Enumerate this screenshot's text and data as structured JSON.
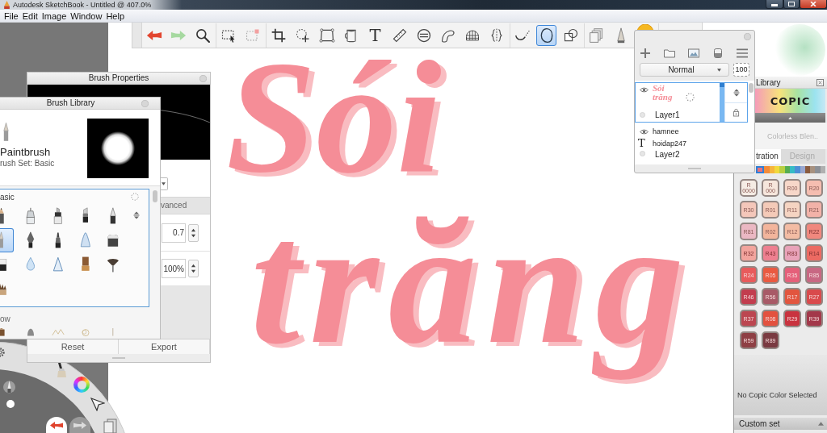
{
  "window": {
    "title": "Autodesk SketchBook - Untitled @ 407.0%"
  },
  "menu": [
    "File",
    "Edit",
    "Image",
    "Window",
    "Help"
  ],
  "toolbar": {
    "groups": [
      [
        {
          "kind": "undo",
          "selected": false
        },
        {
          "kind": "redo",
          "selected": false
        },
        {
          "kind": "zoom",
          "selected": false
        }
      ],
      [
        {
          "kind": "select",
          "selected": false
        },
        {
          "kind": "selectmove",
          "selected": false
        }
      ],
      [
        {
          "kind": "crop",
          "selected": false
        },
        {
          "kind": "transform",
          "selected": false
        },
        {
          "kind": "distort",
          "selected": false
        },
        {
          "kind": "fill",
          "selected": false
        },
        {
          "kind": "text",
          "glyph": "T",
          "selected": false
        },
        {
          "kind": "ruler",
          "selected": false
        },
        {
          "kind": "ellipse",
          "selected": false
        },
        {
          "kind": "curve",
          "selected": false
        },
        {
          "kind": "perspective",
          "selected": false
        },
        {
          "kind": "symmetry",
          "selected": false
        }
      ],
      [
        {
          "kind": "stroke",
          "selected": false
        },
        {
          "kind": "predictive",
          "selected": true
        },
        {
          "kind": "shapes",
          "selected": false
        }
      ],
      [
        {
          "kind": "copy",
          "selected": false
        },
        {
          "kind": "brush",
          "selected": false
        },
        {
          "kind": "color",
          "selected": false
        }
      ]
    ]
  },
  "canvas": {
    "lettering": [
      "Sói",
      "trăng"
    ]
  },
  "brush_properties": {
    "title": "Brush Properties",
    "tab": {
      "label": "vanced",
      "selected": false
    },
    "fields": [
      {
        "value": "0.7"
      },
      {
        "value": "100%"
      }
    ],
    "buttons": [
      "Reset",
      "Export"
    ]
  },
  "brush_library": {
    "title": "Brush Library",
    "brush_name": "Paintbrush",
    "brush_set": "rush Set: Basic",
    "sections": [
      {
        "label": "asic",
        "selected": true,
        "brushes": [
          {
            "kind": "pencil",
            "selected": false
          },
          {
            "kind": "techpen",
            "selected": false
          },
          {
            "kind": "marker",
            "selected": false
          },
          {
            "kind": "chisel",
            "selected": false
          },
          {
            "kind": "ballpoint",
            "selected": false
          },
          {
            "kind": "paintbrush",
            "selected": true
          },
          {
            "kind": "nib",
            "selected": false
          },
          {
            "kind": "felt",
            "selected": false
          },
          {
            "kind": "airbrush",
            "selected": false
          },
          {
            "kind": "eraser",
            "selected": false
          },
          {
            "kind": "block",
            "selected": false
          },
          {
            "kind": "drop",
            "selected": false
          },
          {
            "kind": "cone",
            "selected": false
          },
          {
            "kind": "stamp",
            "selected": false
          },
          {
            "kind": "fan",
            "selected": false
          },
          {
            "kind": "bristle",
            "selected": false
          }
        ]
      },
      {
        "label": "ow",
        "selected": false,
        "brushes": [
          {
            "kind": "dab",
            "selected": false
          },
          {
            "kind": "blob",
            "selected": false
          },
          {
            "kind": "sketch",
            "selected": false
          },
          {
            "kind": "loop",
            "selected": false
          },
          {
            "kind": "hair",
            "selected": false
          }
        ]
      }
    ]
  },
  "layers": {
    "blend_mode": "Normal",
    "opacity": "100",
    "items": [
      {
        "name": "Layer1",
        "kind": "paint",
        "visible": true,
        "selected": true,
        "thumbnail": [
          "Sói",
          "trăng"
        ]
      },
      {
        "name": "Layer2",
        "kind": "text",
        "glyph": "T",
        "visible": true,
        "selected": false,
        "thumbnail": [
          "hamnee",
          "hoidap247"
        ]
      }
    ]
  },
  "copic_library": {
    "title": "Library",
    "logo": "COPIC",
    "blender": "Colorless Blen..",
    "tabs": [
      {
        "label": "tration",
        "selected": true
      },
      {
        "label": "Design",
        "selected": false
      }
    ],
    "families": [
      {
        "color": "#e8727c",
        "selected": true
      },
      {
        "color": "#f28b3b",
        "selected": false
      },
      {
        "color": "#f6b53c",
        "selected": false
      },
      {
        "color": "#f1d93c",
        "selected": false
      },
      {
        "color": "#b8cf41",
        "selected": false
      },
      {
        "color": "#55ad52",
        "selected": false
      },
      {
        "color": "#36bcc4",
        "selected": false
      },
      {
        "color": "#4c8fd6",
        "selected": false
      },
      {
        "color": "#98a6cf",
        "selected": false
      },
      {
        "color": "#8a5b3e",
        "selected": false
      },
      {
        "color": "#a7917f",
        "selected": false
      },
      {
        "color": "#8c9096",
        "selected": false
      },
      {
        "color": "#b0b0b0",
        "selected": false
      }
    ],
    "swatches": [
      {
        "label": "R\n0000",
        "color": "#f5ece4"
      },
      {
        "label": "R\n000",
        "color": "#f6e6dc"
      },
      {
        "label": "R00",
        "color": "#f7d7c9"
      },
      {
        "label": "R20",
        "color": "#f5bdb0"
      },
      {
        "label": "R30",
        "color": "#f4c7ba"
      },
      {
        "label": "R01",
        "color": "#f4cab8"
      },
      {
        "label": "R11",
        "color": "#f5d4c2"
      },
      {
        "label": "R21",
        "color": "#f2b2a8"
      },
      {
        "label": "R81",
        "color": "#ebb8c3"
      },
      {
        "label": "R02",
        "color": "#f3b59c"
      },
      {
        "label": "R12",
        "color": "#f3bca4"
      },
      {
        "label": "R22",
        "color": "#f0887e"
      },
      {
        "label": "R32",
        "color": "#f2a49d"
      },
      {
        "label": "R43",
        "color": "#ee7f90"
      },
      {
        "label": "R83",
        "color": "#e9a3b9"
      },
      {
        "label": "R14",
        "color": "#ec6a62"
      },
      {
        "label": "R24",
        "color": "#e85b5c"
      },
      {
        "label": "R05",
        "color": "#ea5a41"
      },
      {
        "label": "R35",
        "color": "#e5607a"
      },
      {
        "label": "R85",
        "color": "#c86883"
      },
      {
        "label": "R46",
        "color": "#c23d4e"
      },
      {
        "label": "R56",
        "color": "#a85a67"
      },
      {
        "label": "R17",
        "color": "#e2553e"
      },
      {
        "label": "R27",
        "color": "#d94a4c"
      },
      {
        "label": "R37",
        "color": "#bc4650"
      },
      {
        "label": "R08",
        "color": "#e3513f"
      },
      {
        "label": "R29",
        "color": "#c9333f"
      },
      {
        "label": "R39",
        "color": "#a3384a"
      },
      {
        "label": "R59",
        "color": "#8e3f44"
      },
      {
        "label": "R89",
        "color": "#7a3a41"
      }
    ],
    "status": "No Copic Color Selected",
    "custom_set": "Custom set"
  }
}
